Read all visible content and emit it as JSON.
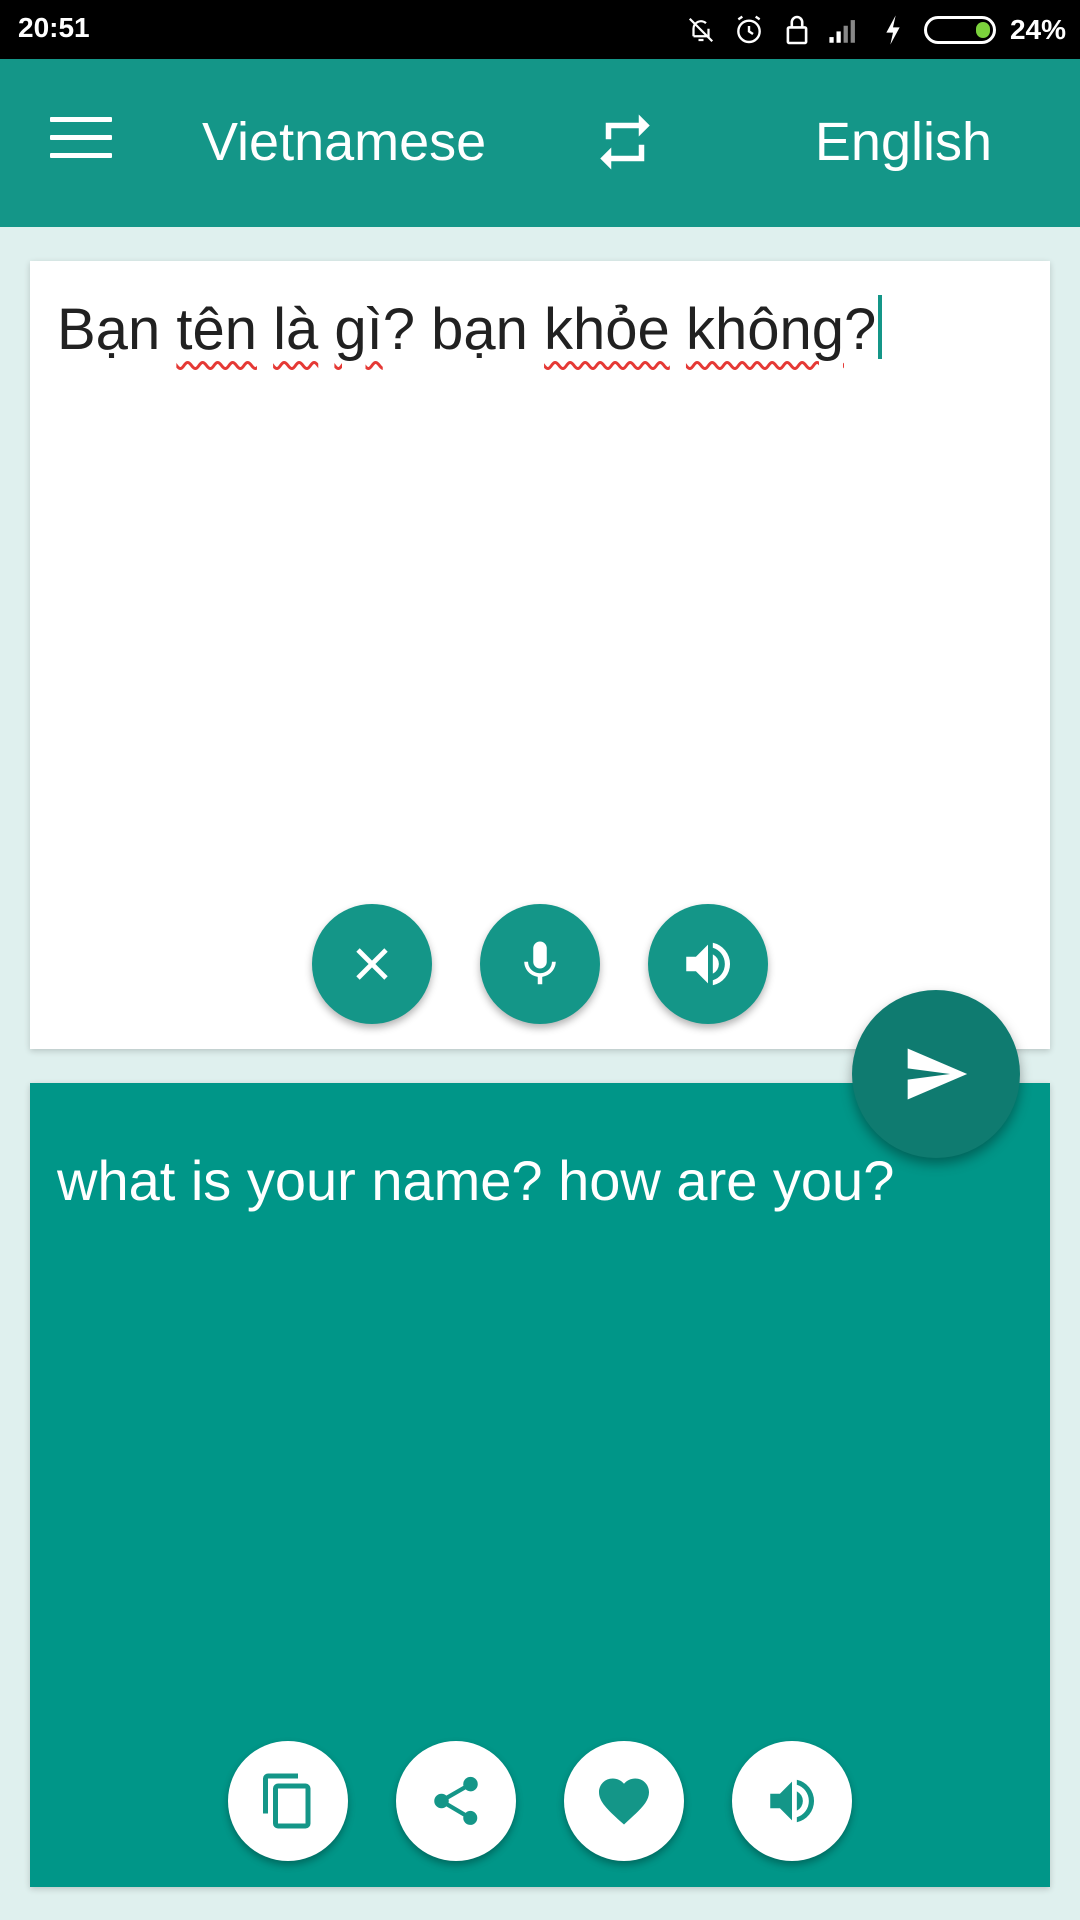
{
  "status_bar": {
    "time": "20:51",
    "battery_percent_label": "24%",
    "battery_level": 0.24,
    "icons": [
      "notifications-off-icon",
      "alarm-icon",
      "lock-icon",
      "signal-icon",
      "charging-icon",
      "battery-icon"
    ]
  },
  "app_bar": {
    "menu_icon": "menu-icon",
    "source_language": "Vietnamese",
    "swap_icon": "swap-icon",
    "target_language": "English"
  },
  "input": {
    "words": [
      {
        "text": "Bạn",
        "misspelled": false
      },
      {
        "text": "tên",
        "misspelled": true
      },
      {
        "text": "là",
        "misspelled": true
      },
      {
        "text": "gì",
        "misspelled": true,
        "suffix": "?"
      },
      {
        "text": "bạn",
        "misspelled": false
      },
      {
        "text": "khỏe",
        "misspelled": true
      },
      {
        "text": "không",
        "misspelled": true,
        "suffix": "?"
      }
    ],
    "value": "Bạn tên là gì? bạn khỏe không?",
    "actions": {
      "clear_icon": "close-icon",
      "mic_icon": "microphone-icon",
      "speak_icon": "speaker-icon"
    }
  },
  "translate_button": {
    "icon": "send-icon"
  },
  "output": {
    "text": "what is your name? how are you?",
    "actions": {
      "copy_icon": "copy-icon",
      "share_icon": "share-icon",
      "favorite_icon": "heart-icon",
      "speak_icon": "speaker-icon"
    }
  },
  "colors": {
    "primary": "#149688",
    "primary_dark": "#0f7b70",
    "output_bg": "#009688",
    "background": "#dff0ee",
    "spellcheck": "#e53935"
  }
}
